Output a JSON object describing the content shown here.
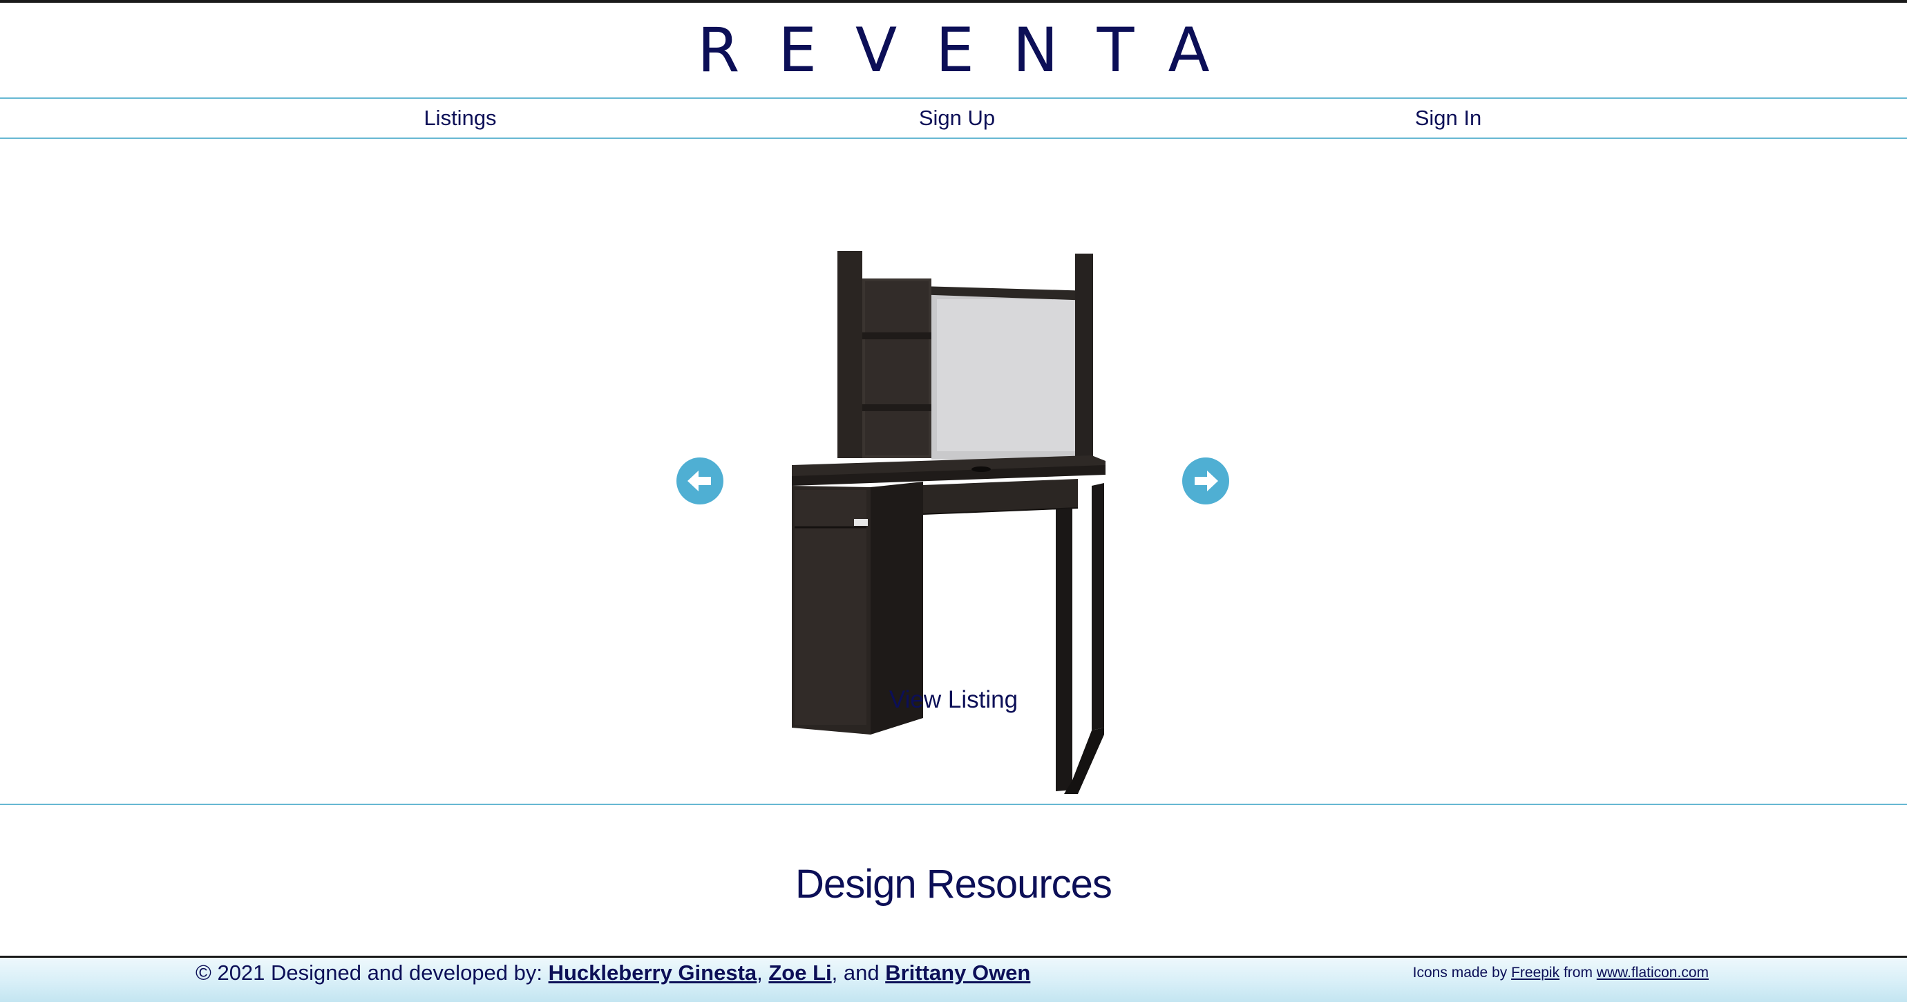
{
  "header": {
    "site_title": "REVENTA"
  },
  "nav": {
    "listings": "Listings",
    "sign_up": "Sign Up",
    "sign_in": "Sign In"
  },
  "carousel": {
    "view_listing": "View Listing",
    "prev_icon": "arrow-left-circle-icon",
    "next_icon": "arrow-right-circle-icon",
    "image": "dark-brown-desk-with-hutch-photo",
    "arrow_color": "#4fafd3"
  },
  "resources": {
    "heading": "Design Resources"
  },
  "footer": {
    "copyright_prefix": "© 2021 Designed and developed by: ",
    "author_1": "Huckleberry Ginesta",
    "separator_1": ", ",
    "author_2": "Zoe Li",
    "separator_2": ", and ",
    "author_3": "Brittany Owen",
    "icons_prefix": "Icons made by ",
    "icons_author": "Freepik",
    "icons_middle": " from ",
    "icons_site": "www.flaticon.com"
  },
  "colors": {
    "brand_navy": "#0c0f57",
    "accent_line": "#67b8d3",
    "footer_bg": "#d6eef7"
  }
}
